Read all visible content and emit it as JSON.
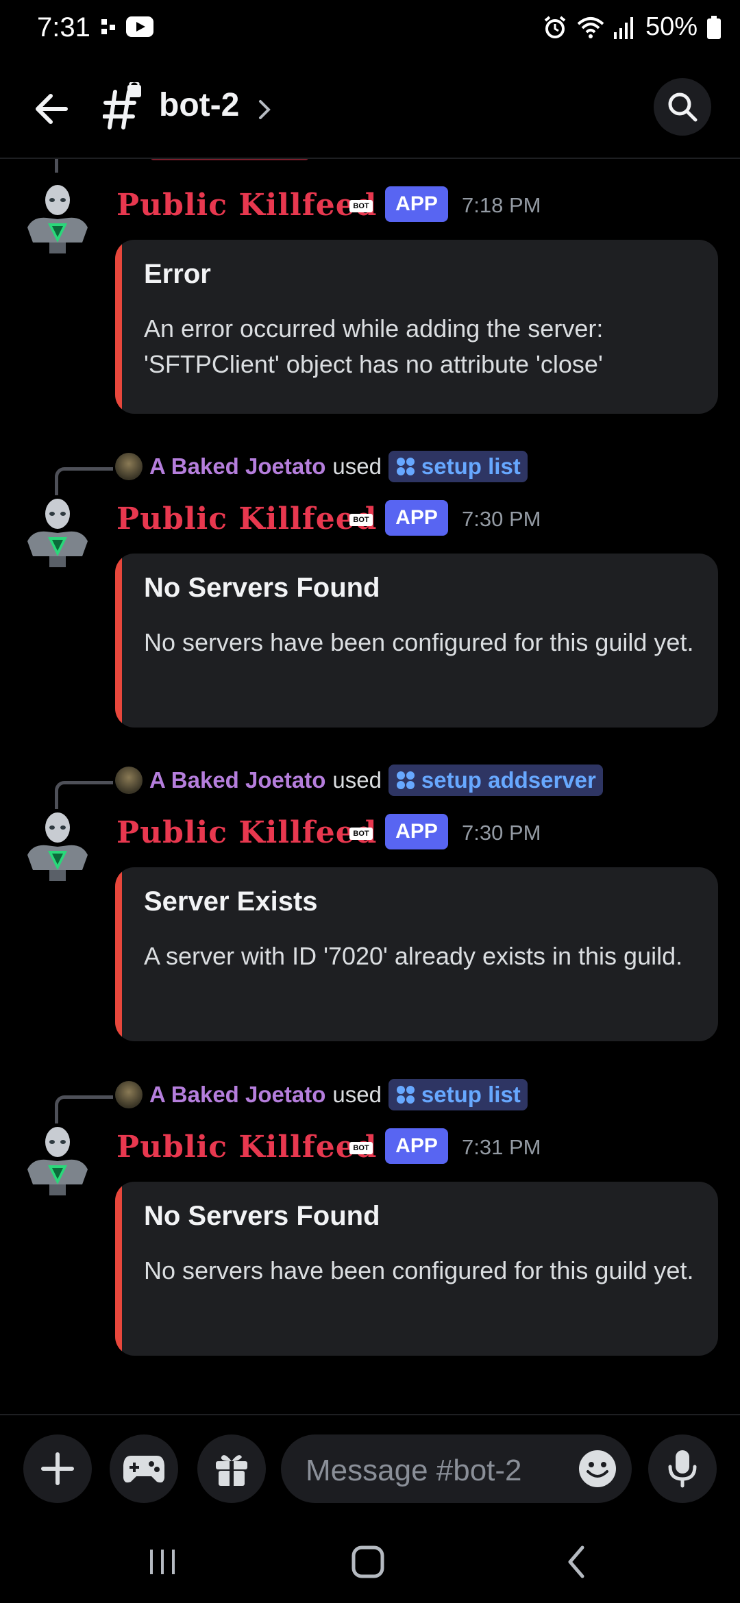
{
  "status_bar": {
    "time": "7:31",
    "battery": "50%"
  },
  "header": {
    "channel_name": "bot-2",
    "icons": [
      "back-arrow-icon",
      "locked-channel-icon",
      "chevron-right-icon",
      "search-icon"
    ]
  },
  "messages": [
    {
      "bot_name": "Public Killfeed",
      "bot_tag": "BOT",
      "app_badge": "APP",
      "time": "7:18 PM",
      "embed_title": "Error",
      "embed_desc": "An error occurred while adding the server: 'SFTPClient' object has no attribute 'close'"
    },
    {
      "reply_user": "A Baked Joetato",
      "reply_used": "used",
      "command": "setup list",
      "bot_name": "Public Killfeed",
      "bot_tag": "BOT",
      "app_badge": "APP",
      "time": "7:30 PM",
      "embed_title": "No Servers Found",
      "embed_desc": "No servers have been configured for this guild yet."
    },
    {
      "reply_user": "A Baked Joetato",
      "reply_used": "used",
      "command": "setup addserver",
      "bot_name": "Public Killfeed",
      "bot_tag": "BOT",
      "app_badge": "APP",
      "time": "7:30 PM",
      "embed_title": "Server Exists",
      "embed_desc": "A server with ID '7020' already exists in this guild."
    },
    {
      "reply_user": "A Baked Joetato",
      "reply_used": "used",
      "command": "setup list",
      "bot_name": "Public Killfeed",
      "bot_tag": "BOT",
      "app_badge": "APP",
      "time": "7:31 PM",
      "embed_title": "No Servers Found",
      "embed_desc": "No servers have been configured for this guild yet."
    }
  ],
  "composer": {
    "placeholder": "Message #bot-2",
    "icons": [
      "plus-icon",
      "gamepad-icon",
      "gift-icon",
      "emoji-icon",
      "microphone-icon"
    ]
  },
  "colors": {
    "bot_name": "#e8384f",
    "app_badge": "#5865f2",
    "embed_bar": "#e8473c",
    "reply_user": "#b57edc",
    "command": "#67a8ff"
  }
}
